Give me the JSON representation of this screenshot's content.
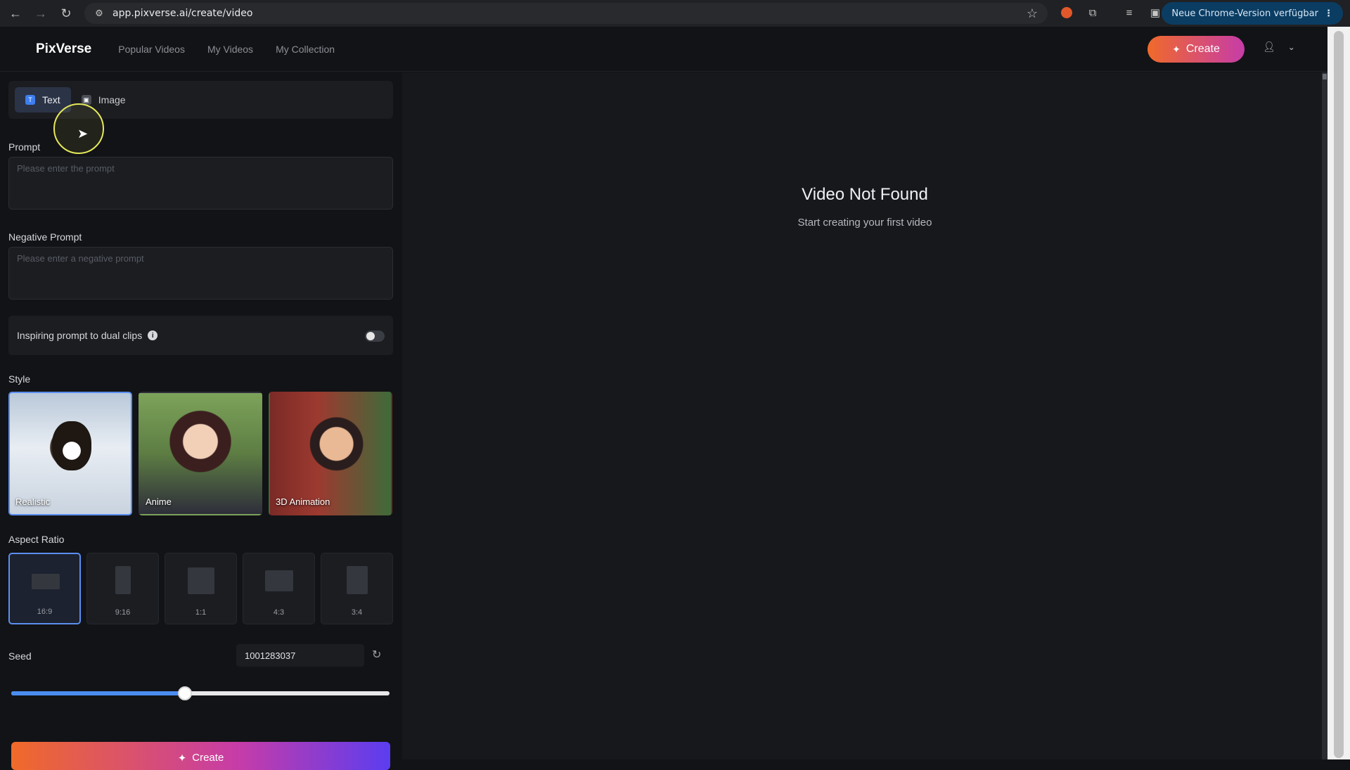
{
  "browser": {
    "url": "app.pixverse.ai/create/video",
    "update_label": "Neue Chrome-Version verfügbar"
  },
  "header": {
    "logo": "PixVerse",
    "nav": [
      "Popular Videos",
      "My Videos",
      "My Collection"
    ],
    "create_label": "Create"
  },
  "left": {
    "tabs": [
      {
        "label": "Text",
        "active": true
      },
      {
        "label": "Image",
        "active": false
      }
    ],
    "prompt_label": "Prompt",
    "prompt_placeholder": "Please enter the prompt",
    "negative_label": "Negative Prompt",
    "negative_placeholder": "Please enter a negative prompt",
    "dual_clips_label": "Inspiring prompt to dual clips",
    "dual_clips_enabled": false,
    "style_label": "Style",
    "styles": [
      {
        "label": "Realistic",
        "selected": true
      },
      {
        "label": "Anime",
        "selected": false
      },
      {
        "label": "3D Animation",
        "selected": false
      }
    ],
    "aspect_label": "Aspect Ratio",
    "ratios": [
      {
        "label": "16:9",
        "selected": true
      },
      {
        "label": "9:16",
        "selected": false
      },
      {
        "label": "1:1",
        "selected": false
      },
      {
        "label": "4:3",
        "selected": false
      },
      {
        "label": "3:4",
        "selected": false
      }
    ],
    "seed_label": "Seed",
    "seed_value": "1001283037",
    "seed_slider_fraction": 0.46,
    "create_label": "Create"
  },
  "right": {
    "empty_title": "Video Not Found",
    "empty_subtitle": "Start creating your first video"
  },
  "colors": {
    "accent": "#4b8cf0",
    "create_gradient_start": "#f06a2a",
    "create_gradient_end": "#c63ca8"
  }
}
